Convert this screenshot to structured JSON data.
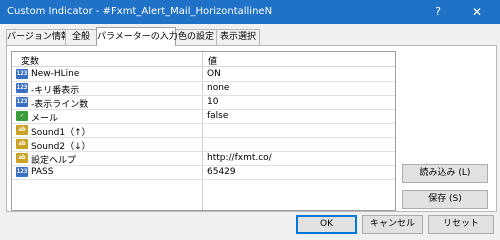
{
  "window": {
    "title": "Custom Indicator - #Fxmt_Alert_Mail_HorizontallineN",
    "help_glyph": "?",
    "close_glyph": "✕"
  },
  "tabs": [
    {
      "label": "バージョン情報"
    },
    {
      "label": "全般"
    },
    {
      "label": "パラメーターの入力",
      "active": true
    },
    {
      "label": "色の設定"
    },
    {
      "label": "表示選択"
    }
  ],
  "grid": {
    "headers": {
      "variable": "変数",
      "value": "値"
    },
    "rows": [
      {
        "icon": "integer-icon",
        "icon_text": "123",
        "icon_color": "#3a6fc4",
        "name": "New-HLine",
        "value": "ON"
      },
      {
        "icon": "integer-icon",
        "icon_text": "123",
        "icon_color": "#3a6fc4",
        "name": "-キリ番表示",
        "value": "none"
      },
      {
        "icon": "integer-icon",
        "icon_text": "123",
        "icon_color": "#3a6fc4",
        "name": "-表示ライン数",
        "value": "10"
      },
      {
        "icon": "boolean-icon",
        "icon_text": "✓",
        "icon_color": "#3a9c3a",
        "name": "メール",
        "value": "false"
      },
      {
        "icon": "string-icon",
        "icon_text": "ab",
        "icon_color": "#c9a227",
        "name": "Sound1（↑）",
        "value": ""
      },
      {
        "icon": "string-icon",
        "icon_text": "ab",
        "icon_color": "#c9a227",
        "name": "Sound2（↓）",
        "value": ""
      },
      {
        "icon": "string-icon",
        "icon_text": "ab",
        "icon_color": "#c9a227",
        "name": "設定ヘルプ",
        "value": "http://fxmt.co/"
      },
      {
        "icon": "integer-icon",
        "icon_text": "123",
        "icon_color": "#3a6fc4",
        "name": "PASS",
        "value": "65429"
      }
    ]
  },
  "side_buttons": {
    "load": "読み込み (L)",
    "save": "保存 (S)"
  },
  "footer_buttons": {
    "ok": "OK",
    "cancel": "キャンセル",
    "reset": "リセット"
  }
}
